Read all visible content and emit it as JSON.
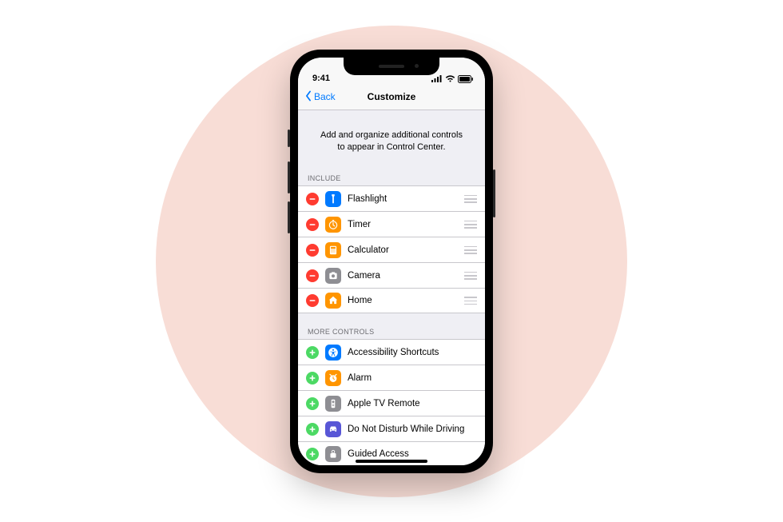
{
  "status": {
    "time": "9:41"
  },
  "nav": {
    "back": "Back",
    "title": "Customize"
  },
  "description": "Add and organize additional controls to appear in Control Center.",
  "sections": {
    "include_header": "INCLUDE",
    "more_header": "MORE CONTROLS"
  },
  "include": [
    {
      "label": "Flashlight",
      "icon": "flashlight",
      "color": "blue"
    },
    {
      "label": "Timer",
      "icon": "timer",
      "color": "orange"
    },
    {
      "label": "Calculator",
      "icon": "calculator",
      "color": "orange"
    },
    {
      "label": "Camera",
      "icon": "camera",
      "color": "gray"
    },
    {
      "label": "Home",
      "icon": "home",
      "color": "orange"
    }
  ],
  "more": [
    {
      "label": "Accessibility Shortcuts",
      "icon": "accessibility",
      "color": "blue"
    },
    {
      "label": "Alarm",
      "icon": "alarm",
      "color": "orange"
    },
    {
      "label": "Apple TV Remote",
      "icon": "remote",
      "color": "gray"
    },
    {
      "label": "Do Not Disturb While Driving",
      "icon": "car",
      "color": "purple"
    },
    {
      "label": "Guided Access",
      "icon": "lock",
      "color": "gray"
    }
  ]
}
